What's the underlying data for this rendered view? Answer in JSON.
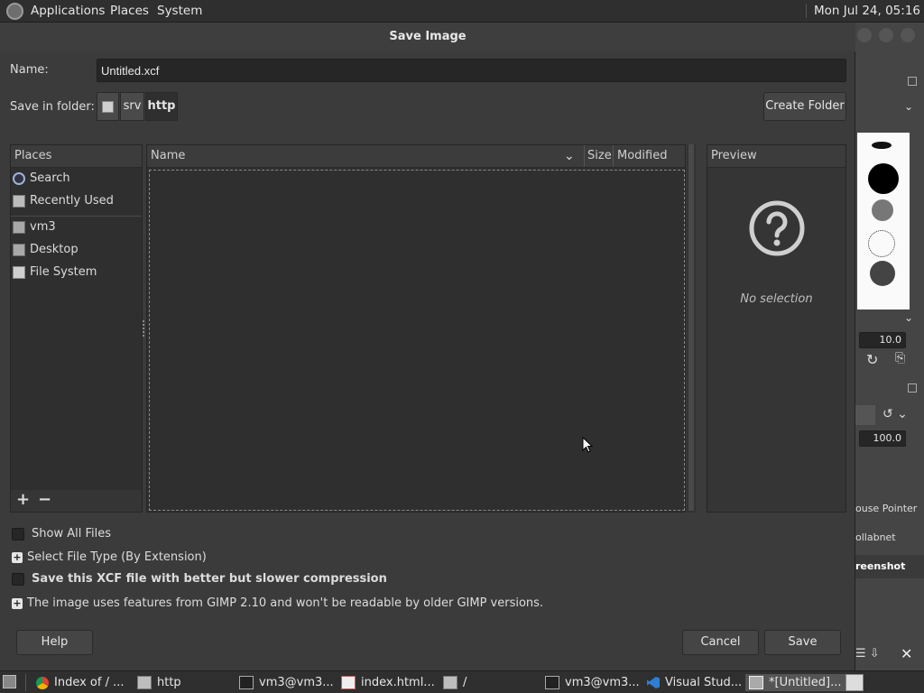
{
  "topbar": {
    "applications": "Applications",
    "places": "Places",
    "system": "System",
    "clock": "Mon Jul 24, 05:16"
  },
  "dialog": {
    "title": "Save Image",
    "name_label": "Name:",
    "name_value": "Untitled.xcf",
    "folder_label": "Save in folder:",
    "path": [
      "srv",
      "http"
    ],
    "create_folder": "Create Folder",
    "places_header": "Places",
    "places": [
      "Search",
      "Recently Used",
      "vm3",
      "Desktop",
      "File System"
    ],
    "columns": {
      "name": "Name",
      "size": "Size",
      "modified": "Modified"
    },
    "preview_header": "Preview",
    "preview_text": "No selection",
    "show_all_files": "Show All Files",
    "select_file_type": "Select File Type (By Extension)",
    "compression": "Save this XCF file with better but slower compression",
    "compat_note": "The image uses features from GIMP 2.10 and won't be readable by older GIMP versions.",
    "help": "Help",
    "cancel": "Cancel",
    "save": "Save"
  },
  "gimp_bg": {
    "spacing_value": "10.0",
    "opacity_value": "100.0",
    "layers": [
      "ouse Pointer",
      "ollabnet",
      "reenshot"
    ]
  },
  "taskbar": [
    {
      "label": "Index of / ...",
      "icon": "chrome-icon"
    },
    {
      "label": "http",
      "icon": "folder-icon"
    },
    {
      "label": "vm3@vm3...",
      "icon": "terminal-icon"
    },
    {
      "label": "index.html...",
      "icon": "editor-icon"
    },
    {
      "label": "/",
      "icon": "folder-icon"
    },
    {
      "label": "vm3@vm3...",
      "icon": "terminal-icon"
    },
    {
      "label": "Visual Stud...",
      "icon": "vscode-icon"
    },
    {
      "label": "*[Untitled]...",
      "icon": "gimp-icon"
    }
  ]
}
